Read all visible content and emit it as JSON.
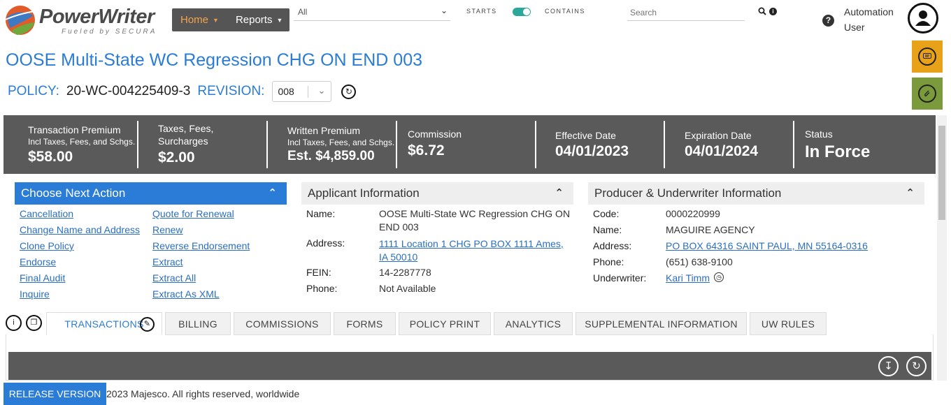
{
  "brand": {
    "name": "PowerWriter",
    "tagline": "Fueled by SECURA"
  },
  "nav": {
    "home": "Home",
    "reports": "Reports"
  },
  "search": {
    "scope": "All",
    "starts_label": "STARTS",
    "contains_label": "CONTAINS",
    "placeholder": "Search"
  },
  "user": {
    "line1": "Automation",
    "line2": "User"
  },
  "page": {
    "title": "OOSE Multi-State WC Regression CHG ON END 003",
    "policy_label": "POLICY:",
    "policy_number": "20-WC-004225409-3",
    "revision_label": "REVISION:",
    "revision_value": "008"
  },
  "summary": [
    {
      "t1": "Transaction Premium",
      "t2": "Incl Taxes, Fees, and Schgs.",
      "value": "$58.00"
    },
    {
      "t1": "Taxes, Fees,",
      "t2": "Surcharges",
      "value": "$2.00"
    },
    {
      "t1": "Written Premium",
      "t2": "Incl Taxes, Fees, and Schgs.",
      "value": "Est. $4,859.00"
    },
    {
      "t1": "Commission",
      "t2": "",
      "value": "$6.72"
    },
    {
      "t1": "Effective Date",
      "t2": "",
      "value": "04/01/2023"
    },
    {
      "t1": "Expiration Date",
      "t2": "",
      "value": "04/01/2024"
    },
    {
      "t1": "Status",
      "t2": "",
      "value": "In Force"
    }
  ],
  "next_action": {
    "title": "Choose Next Action",
    "left": [
      "Cancellation",
      "Change Name and Address",
      "Clone Policy",
      "Endorse",
      "Final Audit",
      "Inquire"
    ],
    "right": [
      "Quote for Renewal",
      "Renew",
      "Reverse Endorsement",
      "Extract",
      "Extract All",
      "Extract As XML"
    ]
  },
  "applicant": {
    "title": "Applicant Information",
    "name_label": "Name:",
    "name_1": "OOSE Multi-State WC Regression CHG ON",
    "name_2": "END 003",
    "address_label": "Address:",
    "address_1": "1111 Location 1 CHG PO BOX 1111 Ames,",
    "address_2": "IA 50010",
    "fein_label": "FEIN:",
    "fein": "14-2287778",
    "phone_label": "Phone:",
    "phone": "Not Available"
  },
  "producer": {
    "title": "Producer & Underwriter Information",
    "code_label": "Code:",
    "code": "0000220999",
    "name_label": "Name:",
    "name": "MAGUIRE AGENCY",
    "address_label": "Address:",
    "address": "PO BOX 64316 SAINT PAUL, MN 55164-0316",
    "phone_label": "Phone:",
    "phone": "(651) 638-9100",
    "underwriter_label": "Underwriter:",
    "underwriter": "Kari Timm"
  },
  "tabs": [
    "TRANSACTIONS",
    "BILLING",
    "COMMISSIONS",
    "FORMS",
    "POLICY PRINT",
    "ANALYTICS",
    "SUPPLEMENTAL INFORMATION",
    "UW RULES"
  ],
  "footer": {
    "release": "RELEASE VERSION",
    "copyright": "2023 Majesco. All rights reserved, worldwide"
  },
  "colors": {
    "accent": "#2a7cd6",
    "band": "#5a5a5a",
    "nav": "#555555",
    "chat": "#e8a21a",
    "attach": "#7a9a3c"
  },
  "icons": [
    "globe-logo-icon",
    "chevron-down-icon",
    "search-icon",
    "info-icon",
    "help-icon",
    "user-avatar-icon",
    "chat-icon",
    "paperclip-icon",
    "refresh-icon",
    "chevron-up-icon",
    "clock-icon",
    "edit-icon",
    "download-icon"
  ]
}
